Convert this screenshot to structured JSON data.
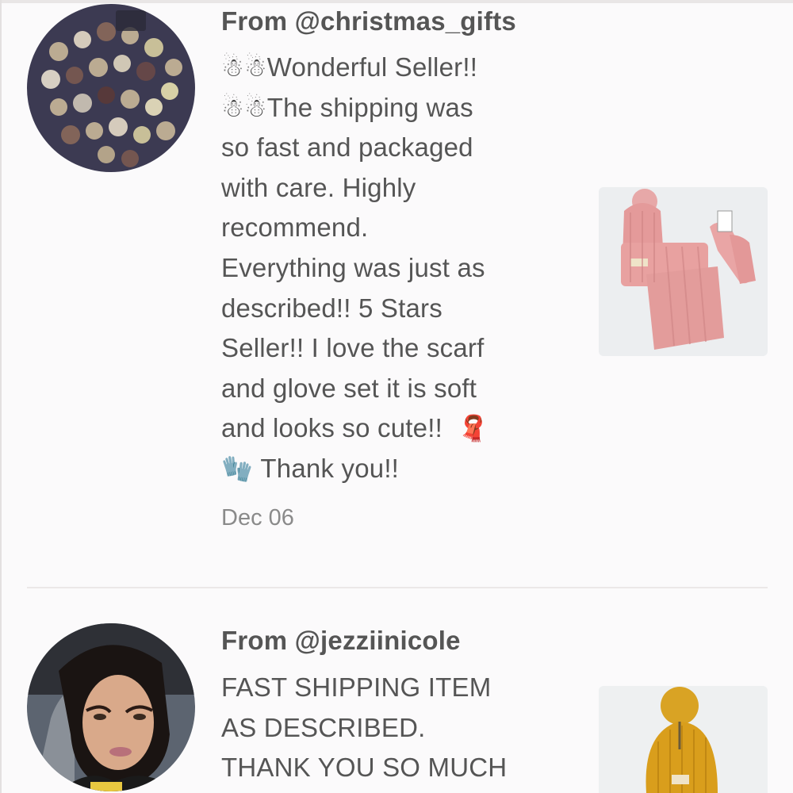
{
  "reviews": [
    {
      "from": "From @christmas_gifts",
      "lines": [
        {
          "emoji_before": [
            "☃",
            "☃"
          ],
          "text": "Wonderful Seller!!"
        },
        {
          "emoji_before": [
            "☃",
            "☃"
          ],
          "text": "The shipping was"
        },
        {
          "text": "so fast and packaged"
        },
        {
          "text": "with care. Highly"
        },
        {
          "text": "recommend."
        },
        {
          "text": "Everything was just as"
        },
        {
          "text": "described!! 5 Stars"
        },
        {
          "text": "Seller!! I love the scarf"
        },
        {
          "text": "and glove set it is soft"
        },
        {
          "text": "and looks so cute!!"
        },
        {
          "text": "Thank you!!"
        }
      ],
      "scarf_emoji": "🧣",
      "glove_emoji": "🧤",
      "date": "Dec 06",
      "avatar_icon": "chocolates-photo",
      "thumbnail_icon": "pink-hat-scarf-gloves-photo"
    },
    {
      "from": "From @jezziinicole",
      "lines": [
        {
          "text": "FAST SHIPPING ITEM"
        },
        {
          "text": "AS DESCRIBED."
        },
        {
          "text": "THANK YOU SO MUCH"
        }
      ],
      "avatar_icon": "user-portrait-photo",
      "thumbnail_icon": "mustard-beanie-photo"
    }
  ],
  "colors": {
    "background": "#fbfafb",
    "text": "#555555",
    "date": "#8a8a8a",
    "divider": "#ebe8e8"
  }
}
